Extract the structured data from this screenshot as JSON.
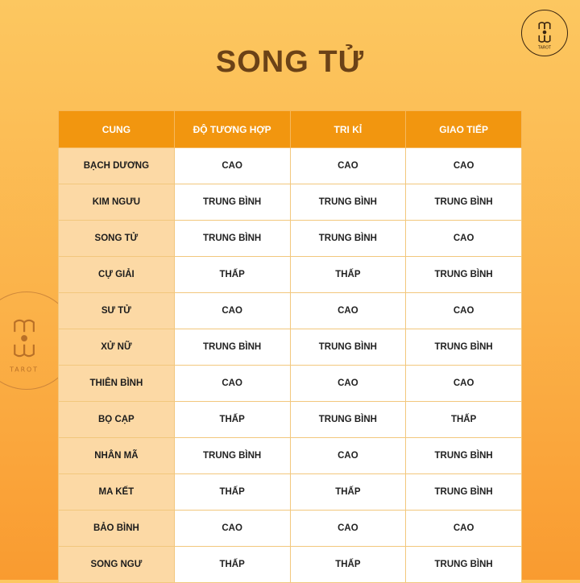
{
  "title": "SONG TỬ",
  "brand": {
    "logo_text": "TAROT",
    "accent": "#f2960f",
    "title_color": "#6b4217"
  },
  "table": {
    "headers": [
      "CUNG",
      "ĐỘ TƯƠNG HỢP",
      "TRI KỈ",
      "GIAO TIẾP"
    ],
    "rows": [
      [
        "BẠCH DƯƠNG",
        "CAO",
        "CAO",
        "CAO"
      ],
      [
        "KIM NGƯU",
        "TRUNG BÌNH",
        "TRUNG BÌNH",
        "TRUNG BÌNH"
      ],
      [
        "SONG TỬ",
        "TRUNG BÌNH",
        "TRUNG BÌNH",
        "CAO"
      ],
      [
        "CỰ GIẢI",
        "THẤP",
        "THẤP",
        "TRUNG BÌNH"
      ],
      [
        "SƯ TỬ",
        "CAO",
        "CAO",
        "CAO"
      ],
      [
        "XỬ NỮ",
        "TRUNG BÌNH",
        "TRUNG BÌNH",
        "TRUNG BÌNH"
      ],
      [
        "THIÊN BÌNH",
        "CAO",
        "CAO",
        "CAO"
      ],
      [
        "BỌ CẠP",
        "THẤP",
        "TRUNG BÌNH",
        "THẤP"
      ],
      [
        "NHÂN MÃ",
        "TRUNG BÌNH",
        "CAO",
        "TRUNG BÌNH"
      ],
      [
        "MA KẾT",
        "THẤP",
        "THẤP",
        "TRUNG BÌNH"
      ],
      [
        "BẢO BÌNH",
        "CAO",
        "CAO",
        "CAO"
      ],
      [
        "SONG NGƯ",
        "THẤP",
        "THẤP",
        "TRUNG BÌNH"
      ]
    ]
  }
}
